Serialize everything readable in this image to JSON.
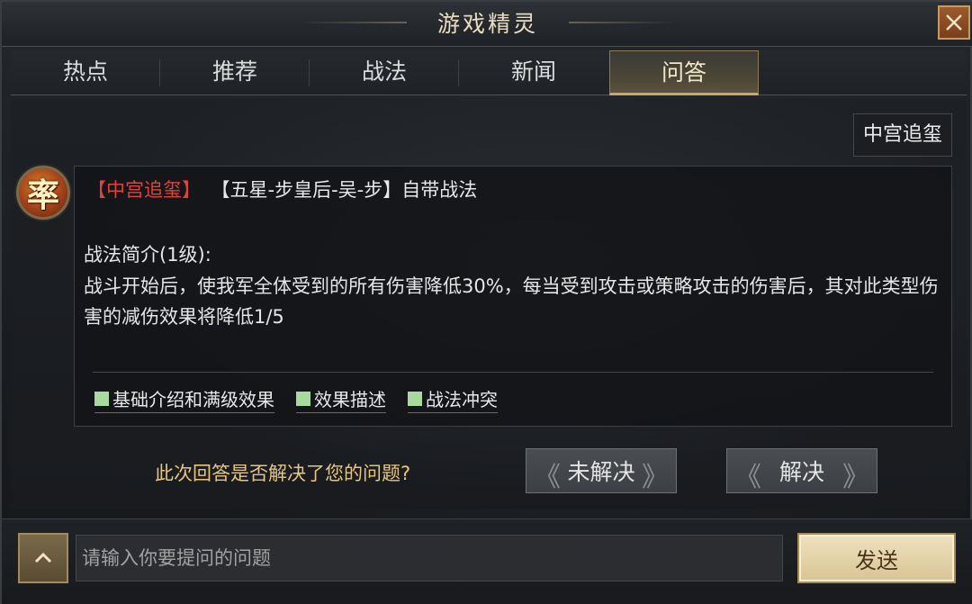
{
  "window": {
    "title": "游戏精灵"
  },
  "tabs": [
    {
      "label": "热点",
      "active": false
    },
    {
      "label": "推荐",
      "active": false
    },
    {
      "label": "战法",
      "active": false
    },
    {
      "label": "新闻",
      "active": false
    },
    {
      "label": "问答",
      "active": true
    }
  ],
  "skill_tag": "中宫追玺",
  "avatar": {
    "glyph": "率",
    "icon": "commander-badge-icon"
  },
  "answer": {
    "skill_name": "【中宫追玺】",
    "source_text": "【五星-步皇后-吴-步】自带战法",
    "desc_title": "战法简介(1级):",
    "desc_body": "战斗开始后，使我军全体受到的所有伤害降低30%，每当受到攻击或策略攻击的伤害后，其对此类型伤害的减伤效果将降低1/5",
    "links": [
      {
        "label": "基础介绍和满级效果"
      },
      {
        "label": "效果描述"
      },
      {
        "label": "战法冲突"
      }
    ]
  },
  "feedback": {
    "question": "此次回答是否解决了您的问题?",
    "unsolved_label": "未解决",
    "solved_label": "解决"
  },
  "input": {
    "placeholder": "请输入你要提问的问题",
    "value": ""
  },
  "send_label": "发送",
  "colors": {
    "accent_gold": "#c8a86a",
    "skill_red": "#e0433a",
    "question_gold": "#e6c77f",
    "link_square_green": "#a7d9a0",
    "close_button": "#9a5a2e"
  }
}
